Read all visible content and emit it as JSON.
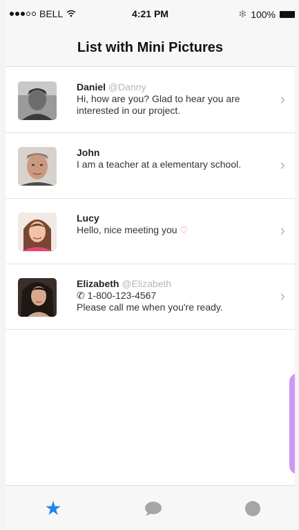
{
  "status_bar": {
    "carrier": "BELL",
    "time": "4:21 PM",
    "battery": "100%"
  },
  "nav": {
    "title": "List with Mini Pictures"
  },
  "contacts": [
    {
      "name": "Daniel",
      "handle": "@Danny",
      "lines": [
        "Hi, how are you? Glad to hear you are",
        "interested in our project."
      ]
    },
    {
      "name": "John",
      "handle": "",
      "lines": [
        "I am a teacher at a elementary school."
      ]
    },
    {
      "name": "Lucy",
      "handle": "",
      "lines": [
        "Hello, nice meeting you"
      ],
      "emoji": "heart-emoji"
    },
    {
      "name": "Elizabeth",
      "handle": "@Elizabeth",
      "phone": "1-800-123-4567",
      "lines": [
        "Please call me when you're ready."
      ]
    }
  ],
  "tabs": [
    {
      "icon": "star-icon",
      "active": true
    },
    {
      "icon": "chat-bubble-icon",
      "active": false
    },
    {
      "icon": "circle-icon",
      "active": false
    }
  ],
  "colors": {
    "accent": "#1f87ee",
    "side_tab": "#cc98f4"
  }
}
